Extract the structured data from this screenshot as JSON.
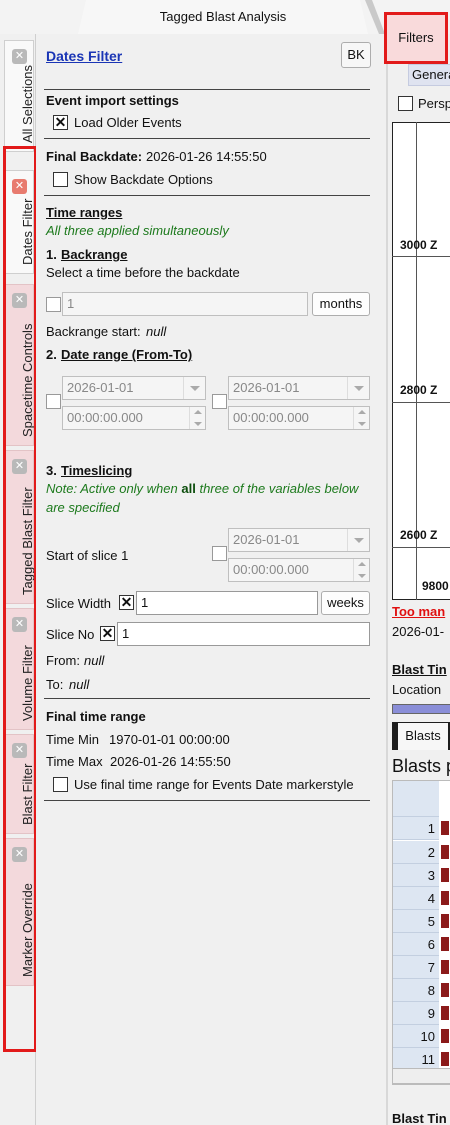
{
  "window": {
    "title": "Tagged Blast Analysis"
  },
  "left_tabs": [
    {
      "label": "All Selections",
      "state": "normal"
    },
    {
      "label": "Dates Filter",
      "state": "selected"
    },
    {
      "label": "Spacetime Controls",
      "state": "highlighted"
    },
    {
      "label": "Tagged Blast Filter",
      "state": "highlighted"
    },
    {
      "label": "Volume Filter",
      "state": "highlighted"
    },
    {
      "label": "Blast Filter",
      "state": "highlighted"
    },
    {
      "label": "Marker Override",
      "state": "highlighted"
    }
  ],
  "panel": {
    "title": "Dates Filter",
    "bk_button": "BK",
    "event_import": {
      "heading": "Event import settings",
      "load_older_label": "Load Older Events",
      "load_older_checked": true
    },
    "final_backdate": {
      "label": "Final Backdate:",
      "value": "2026-01-26 14:55:50",
      "show_options_label": "Show Backdate Options",
      "show_options_checked": false
    },
    "time_ranges": {
      "heading": "Time ranges",
      "note": "All three applied simultaneously",
      "backrange": {
        "number": "1.",
        "title": "Backrange",
        "desc": "Select a time before the backdate",
        "value": "1",
        "unit_button": "months",
        "start_label": "Backrange start:",
        "start_value": "null"
      },
      "date_range": {
        "number": "2.",
        "title": "Date range (From-To)",
        "from_date": "2026-01-01",
        "from_time": "00:00:00.000",
        "to_date": "2026-01-01",
        "to_time": "00:00:00.000"
      },
      "timeslicing": {
        "number": "3.",
        "title": "Timeslicing",
        "note_pre": "Note: Active only when ",
        "note_bold": "all",
        "note_post": " three of the variables below",
        "note_line2": "are specified",
        "start_label": "Start of slice 1",
        "start_date": "2026-01-01",
        "start_time": "00:00:00.000",
        "width_label": "Slice Width",
        "width_value": "1",
        "width_unit": "weeks",
        "no_label": "Slice No",
        "no_value": "1",
        "from_label": "From:",
        "from_value": "null",
        "to_label": "To:",
        "to_value": "null"
      }
    },
    "final_range": {
      "heading": "Final time range",
      "min_label": "Time Min",
      "min_value": "1970-01-01 00:00:00",
      "max_label": "Time Max",
      "max_value": "2026-01-26 14:55:50",
      "use_label": "Use final time range for Events Date markerstyle",
      "use_checked": false
    }
  },
  "right_panel": {
    "filters_tab": "Filters",
    "general_tab": "Genera",
    "perspective_label": "Persp",
    "plot_labels": [
      "3000 Z",
      "2800 Z",
      "2600 Z",
      "9800"
    ],
    "warning": "Too man",
    "date_fragment": "2026-01-",
    "blast_time_heading": "Blast Tin",
    "location_label": "Location",
    "blasts_tab": "Blasts",
    "blasts_title": "Blasts p",
    "row_numbers": [
      "1",
      "2",
      "3",
      "4",
      "5",
      "6",
      "7",
      "8",
      "9",
      "10",
      "11"
    ],
    "bottom_heading": "Blast Tin"
  },
  "colors": {
    "highlight_red": "#e21a1a",
    "link_blue": "#1a35b5",
    "note_green": "#1d7a1d"
  }
}
